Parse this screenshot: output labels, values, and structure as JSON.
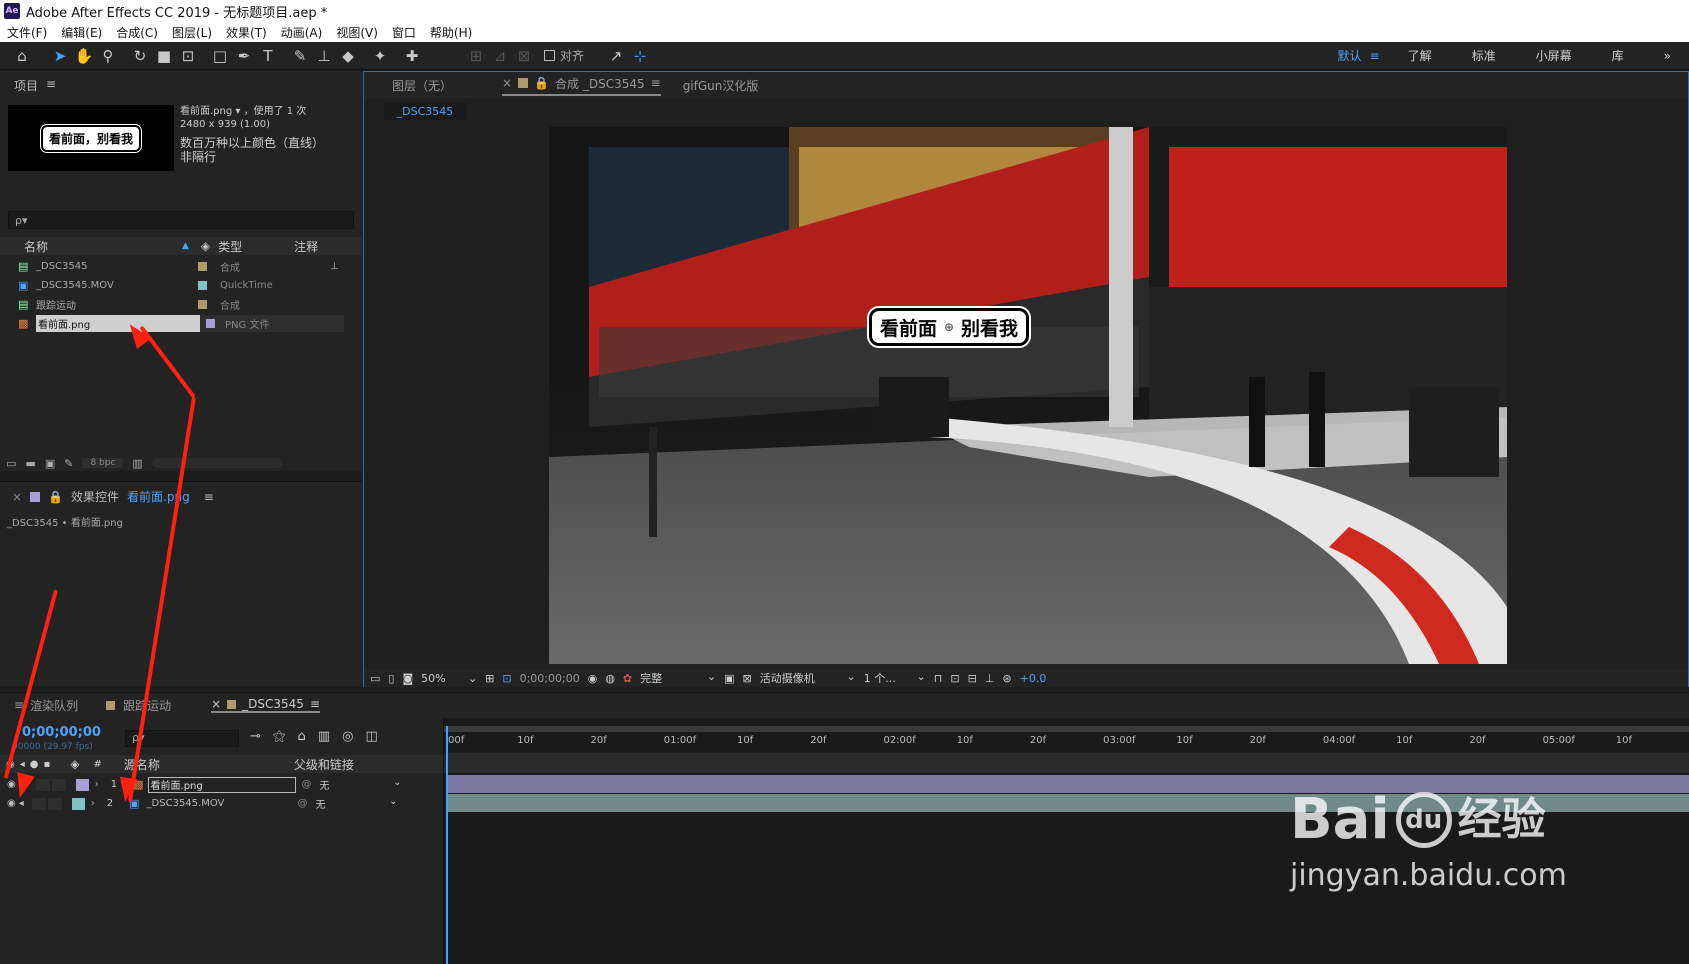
{
  "window": {
    "app_icon": "Ae",
    "title": "Adobe After Effects CC 2019 - 无标题项目.aep *"
  },
  "menu": [
    "文件(F)",
    "编辑(E)",
    "合成(C)",
    "图层(L)",
    "效果(T)",
    "动画(A)",
    "视图(V)",
    "窗口",
    "帮助(H)"
  ],
  "toolbar": {
    "snap_label": "对齐",
    "workspaces": [
      "默认",
      "了解",
      "标准",
      "小屏幕",
      "库"
    ],
    "workspace_more": "»"
  },
  "project": {
    "title": "项目",
    "thumb_text": "看前面，别看我",
    "item_name": "看前面.png",
    "used_text": "，使用了 1 次",
    "dims": "2480 x 939 (1.00)",
    "color_desc": "数百万种以上颜色（直线）",
    "color_desc2": "非隔行",
    "search_placeholder": "ρ▾",
    "col_name": "名称",
    "col_type": "类型",
    "col_note": "注释",
    "items": [
      {
        "name": "_DSC3545",
        "type": "合成",
        "swatch": "#b09a6a"
      },
      {
        "name": "_DSC3545.MOV",
        "type": "QuickTime",
        "swatch": "#7fc4c0"
      },
      {
        "name": "跟踪运动",
        "type": "合成",
        "swatch": "#b09a6a"
      },
      {
        "name": "看前面.png",
        "type": "PNG 文件",
        "swatch": "#a6a0d6"
      }
    ],
    "bpc": "8 bpc"
  },
  "effects": {
    "title": "效果控件",
    "target": "看前面.png",
    "breadcrumb": "_DSC3545 • 看前面.png"
  },
  "viewer": {
    "tabs": [
      "图层（无）",
      "合成 _DSC3545",
      "gifGun汉化版"
    ],
    "comp_chip": "_DSC3545",
    "overlay_left": "看前面",
    "overlay_right": "别看我",
    "zoom": "50%",
    "timecode": "0;00;00;00",
    "quality": "完整",
    "camera": "活动摄像机",
    "views": "1 个...",
    "exposure": "+0.0"
  },
  "timeline": {
    "tabs": [
      "渲染队列",
      "跟踪运动",
      "_DSC3545"
    ],
    "timecode": "0;00;00;00",
    "fps": "00000 (29.97 fps)",
    "search_placeholder": "ρ▾",
    "col_num": "#",
    "col_source": "源名称",
    "col_parent": "父级和链接",
    "ruler": [
      "00f",
      "10f",
      "20f",
      "01:00f",
      "10f",
      "20f",
      "02:00f",
      "10f",
      "20f",
      "03:00f",
      "10f",
      "20f",
      "04:00f",
      "10f",
      "20f",
      "05:00f",
      "10f"
    ],
    "layers": [
      {
        "num": "1",
        "name": "看前面.png",
        "parent": "无",
        "color": "#a6a0d6",
        "bar": "#7a77a0"
      },
      {
        "num": "2",
        "name": "_DSC3545.MOV",
        "parent": "无",
        "color": "#7fc4c0",
        "bar": "#6f8a88"
      }
    ]
  },
  "watermark": {
    "brand": "Bai",
    "brand2": "du",
    "jingyan": "经验",
    "url": "jingyan.baidu.com"
  }
}
